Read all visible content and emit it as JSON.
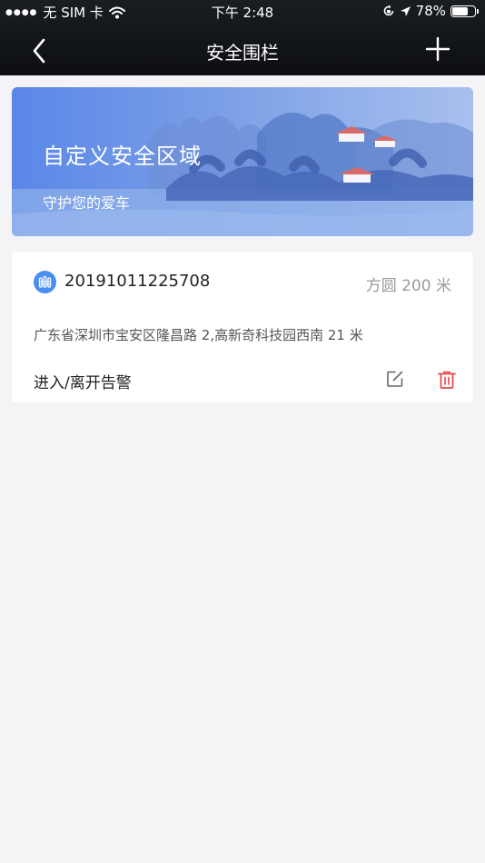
{
  "status_bar": {
    "carrier": "无 SIM 卡",
    "time": "下午 2:48",
    "battery": "78%",
    "battery_level": 0.78
  },
  "nav": {
    "title": "安全围栏",
    "icons": [
      "back-icon",
      "plus-icon"
    ]
  },
  "banner": {
    "title": "自定义安全区域",
    "subtitle": "守护您的爱车"
  },
  "fences": [
    {
      "id": "20191011225708",
      "shape": "方圆 200 米",
      "address": "广东省深圳市宝安区隆昌路 2,高新奇科技园西南 21 米",
      "alarm": "进入/离开告警"
    }
  ],
  "colors": {
    "header_bg": "#121418",
    "banner_start": "#5a87e8",
    "banner_end": "#a8c0ee",
    "accent": "#4a8ef0",
    "delete": "#e04848",
    "page_bg": "#f4f4f6"
  }
}
